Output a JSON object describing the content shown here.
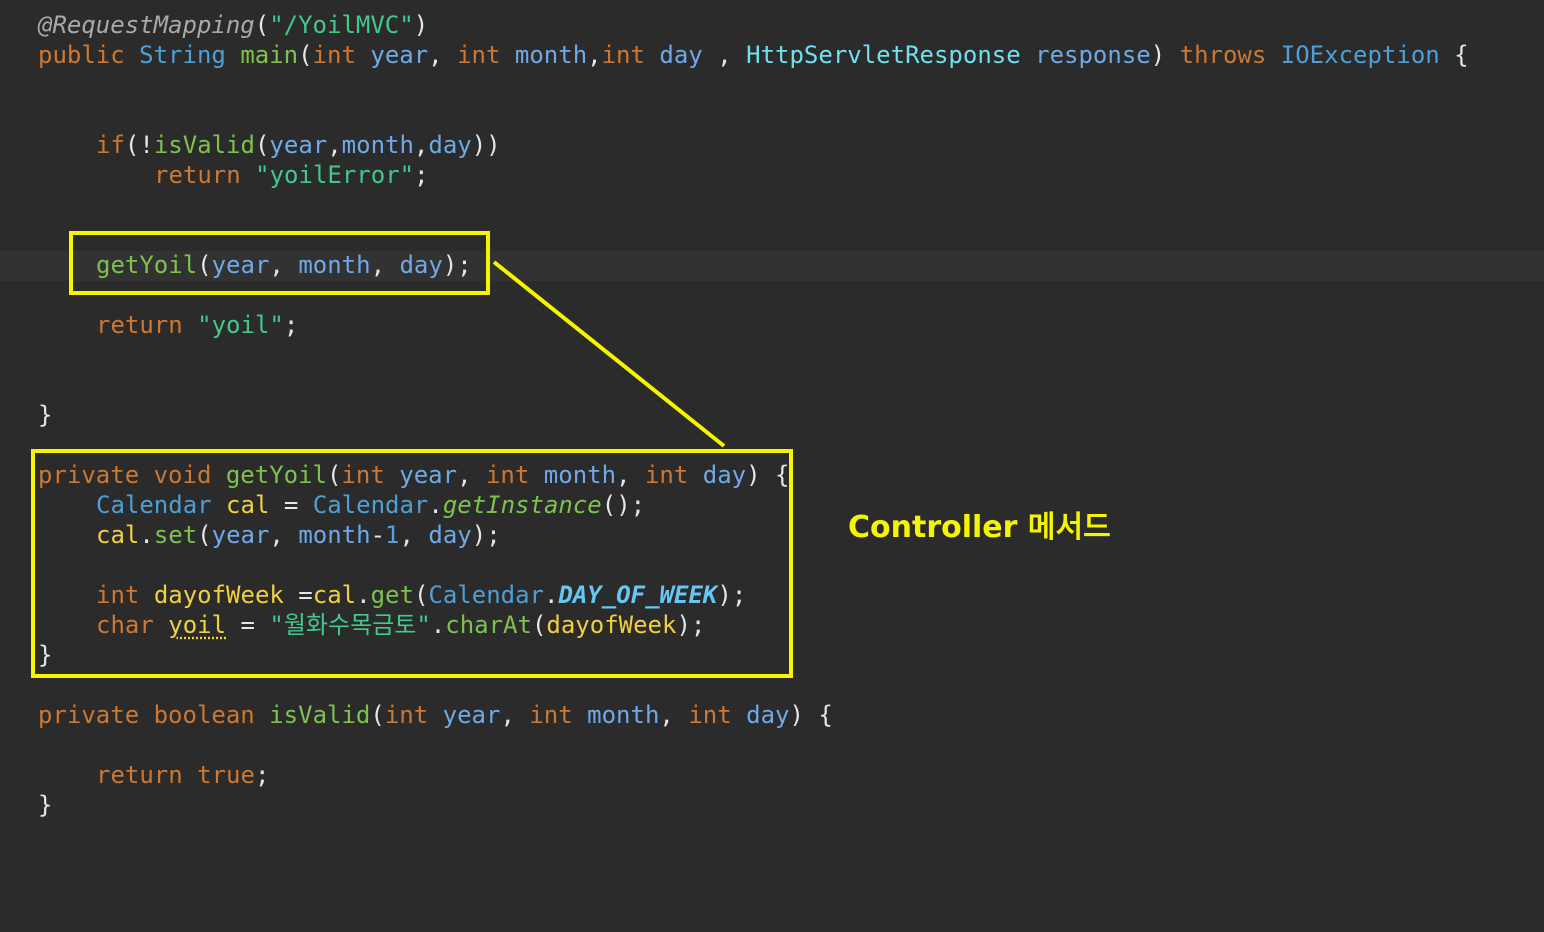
{
  "code": {
    "l1": {
      "ann": "@RequestMapping",
      "p1": "(",
      "str": "\"/YoilMVC\"",
      "p2": ")"
    },
    "l2": {
      "kw1": "public",
      "type1": "String",
      "method": "main",
      "p1": "(",
      "kw2": "int",
      "param1": "year",
      "c1": ", ",
      "kw3": "int",
      "param2": "month",
      "c2": ",",
      "kw4": "int",
      "param3": "day",
      "c3": " , ",
      "type2": "HttpServletResponse",
      "param4": "response",
      "p2": ") ",
      "kw5": "throws",
      "type3": "IOException",
      "brace": " {"
    },
    "l3": {
      "kw": "if",
      "p1": "(!",
      "method": "isValid",
      "p2": "(",
      "a1": "year",
      "c1": ",",
      "a2": "month",
      "c2": ",",
      "a3": "day",
      "p3": "))"
    },
    "l4": {
      "kw": "return",
      "str": "\"yoilError\"",
      "semi": ";"
    },
    "l5": {
      "method": "getYoil",
      "p1": "(",
      "a1": "year",
      "c1": ", ",
      "a2": "month",
      "c2": ", ",
      "a3": "day",
      "p2": ");"
    },
    "l6": {
      "kw": "return",
      "str": "\"yoil\"",
      "semi": ";"
    },
    "l7": {
      "brace": "}"
    },
    "l8": {
      "kw1": "private",
      "kw2": "void",
      "method": "getYoil",
      "p1": "(",
      "kw3": "int",
      "a1": "year",
      "c1": ", ",
      "kw4": "int",
      "a2": "month",
      "c2": ", ",
      "kw5": "int",
      "a3": "day",
      "p2": ") {"
    },
    "l9": {
      "type1": "Calendar",
      "local": "cal",
      "eq": " = ",
      "type2": "Calendar",
      "dot": ".",
      "method": "getInstance",
      "p": "();"
    },
    "l10": {
      "obj": "cal",
      "dot": ".",
      "method": "set",
      "p1": "(",
      "a1": "year",
      "c1": ", ",
      "a2": "month",
      "minus": "-",
      "num": "1",
      "c2": ", ",
      "a3": "day",
      "p2": ");"
    },
    "l11": {
      "kw": "int",
      "local": "dayofWeek",
      "eq": " =",
      "obj": "cal",
      "dot1": ".",
      "method": "get",
      "p1": "(",
      "type": "Calendar",
      "dot2": ".",
      "const": "DAY_OF_WEEK",
      "p2": ");"
    },
    "l12": {
      "kw": "char",
      "local": "yoil",
      "eq": " = ",
      "str": "\"월화수목금토\"",
      "dot": ".",
      "method": "charAt",
      "p1": "(",
      "arg": "dayofWeek",
      "p2": ");"
    },
    "l13": {
      "brace": "}"
    },
    "l14": {
      "kw1": "private",
      "kw2": "boolean",
      "method": "isValid",
      "p1": "(",
      "kw3": "int",
      "a1": "year",
      "c1": ", ",
      "kw4": "int",
      "a2": "month",
      "c2": ", ",
      "kw5": "int",
      "a3": "day",
      "p2": ") {"
    },
    "l15": {
      "kw1": "return",
      "kw2": "true",
      "semi": ";"
    },
    "l16": {
      "brace": "}"
    }
  },
  "annotation": {
    "label": "Controller 메서드",
    "color": "#f5f500"
  },
  "colors": {
    "background": "#2b2b2b",
    "keyword": "#cc7832",
    "type": "#4e9fd6",
    "method": "#7ec24e",
    "string": "#41c98c",
    "highlight": "#f5f500"
  }
}
